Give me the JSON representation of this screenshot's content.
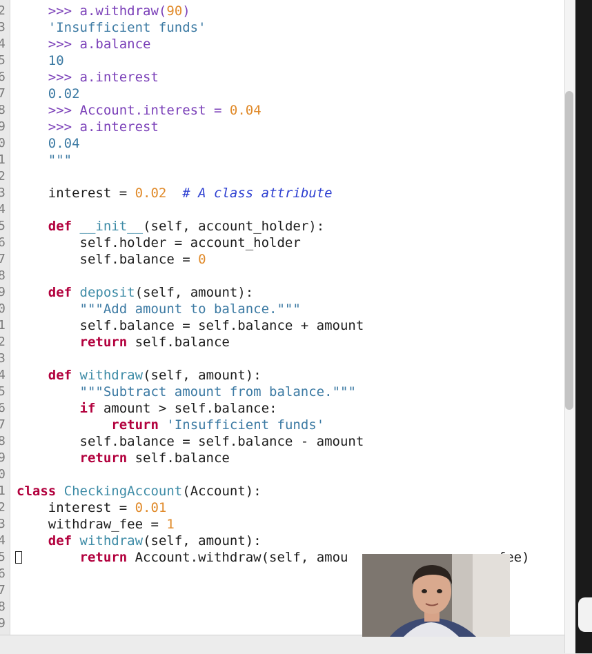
{
  "editor": {
    "lines": [
      {
        "n": "2",
        "tokens": [
          {
            "t": "    "
          },
          {
            "t": ">>> ",
            "c": "prompt"
          },
          {
            "t": "a.withdraw(",
            "c": "prompt"
          },
          {
            "t": "90",
            "c": "num"
          },
          {
            "t": ")",
            "c": "prompt"
          }
        ]
      },
      {
        "n": "3",
        "tokens": [
          {
            "t": "    "
          },
          {
            "t": "'Insufficient funds'",
            "c": "str"
          }
        ]
      },
      {
        "n": "4",
        "tokens": [
          {
            "t": "    "
          },
          {
            "t": ">>> a.balance",
            "c": "prompt"
          }
        ]
      },
      {
        "n": "5",
        "tokens": [
          {
            "t": "    "
          },
          {
            "t": "10",
            "c": "str"
          }
        ]
      },
      {
        "n": "6",
        "tokens": [
          {
            "t": "    "
          },
          {
            "t": ">>> a.interest",
            "c": "prompt"
          }
        ]
      },
      {
        "n": "7",
        "tokens": [
          {
            "t": "    "
          },
          {
            "t": "0.02",
            "c": "str"
          }
        ]
      },
      {
        "n": "8",
        "tokens": [
          {
            "t": "    "
          },
          {
            "t": ">>> Account.interest = ",
            "c": "prompt"
          },
          {
            "t": "0.04",
            "c": "num"
          }
        ]
      },
      {
        "n": "9",
        "tokens": [
          {
            "t": "    "
          },
          {
            "t": ">>> a.interest",
            "c": "prompt"
          }
        ]
      },
      {
        "n": "0",
        "tokens": [
          {
            "t": "    "
          },
          {
            "t": "0.04",
            "c": "str"
          }
        ]
      },
      {
        "n": "1",
        "tokens": [
          {
            "t": "    "
          },
          {
            "t": "\"\"\"",
            "c": "str"
          }
        ]
      },
      {
        "n": "2",
        "tokens": []
      },
      {
        "n": "3",
        "tokens": [
          {
            "t": "    interest = "
          },
          {
            "t": "0.02",
            "c": "num"
          },
          {
            "t": "  "
          },
          {
            "t": "# A class attribute",
            "c": "cmt"
          }
        ]
      },
      {
        "n": "4",
        "tokens": []
      },
      {
        "n": "5",
        "tokens": [
          {
            "t": "    "
          },
          {
            "t": "def",
            "c": "kw"
          },
          {
            "t": " "
          },
          {
            "t": "__init__",
            "c": "fn"
          },
          {
            "t": "(self, account_holder):"
          }
        ]
      },
      {
        "n": "6",
        "tokens": [
          {
            "t": "        self.holder = account_holder"
          }
        ]
      },
      {
        "n": "7",
        "tokens": [
          {
            "t": "        self.balance = "
          },
          {
            "t": "0",
            "c": "num"
          }
        ]
      },
      {
        "n": "8",
        "tokens": []
      },
      {
        "n": "9",
        "tokens": [
          {
            "t": "    "
          },
          {
            "t": "def",
            "c": "kw"
          },
          {
            "t": " "
          },
          {
            "t": "deposit",
            "c": "fn"
          },
          {
            "t": "(self, amount):"
          }
        ]
      },
      {
        "n": "0",
        "tokens": [
          {
            "t": "        "
          },
          {
            "t": "\"\"\"Add amount to balance.\"\"\"",
            "c": "dstr"
          }
        ]
      },
      {
        "n": "1",
        "tokens": [
          {
            "t": "        self.balance = self.balance + amount"
          }
        ]
      },
      {
        "n": "2",
        "tokens": [
          {
            "t": "        "
          },
          {
            "t": "return",
            "c": "kw"
          },
          {
            "t": " self.balance"
          }
        ]
      },
      {
        "n": "3",
        "tokens": []
      },
      {
        "n": "4",
        "tokens": [
          {
            "t": "    "
          },
          {
            "t": "def",
            "c": "kw"
          },
          {
            "t": " "
          },
          {
            "t": "withdraw",
            "c": "fn"
          },
          {
            "t": "(self, amount):"
          }
        ]
      },
      {
        "n": "5",
        "tokens": [
          {
            "t": "        "
          },
          {
            "t": "\"\"\"Subtract amount from balance.\"\"\"",
            "c": "dstr"
          }
        ]
      },
      {
        "n": "6",
        "tokens": [
          {
            "t": "        "
          },
          {
            "t": "if",
            "c": "kw"
          },
          {
            "t": " amount > self.balance:"
          }
        ]
      },
      {
        "n": "7",
        "tokens": [
          {
            "t": "            "
          },
          {
            "t": "return",
            "c": "kw"
          },
          {
            "t": " "
          },
          {
            "t": "'Insufficient funds'",
            "c": "str"
          }
        ]
      },
      {
        "n": "8",
        "tokens": [
          {
            "t": "        self.balance = self.balance - amount"
          }
        ]
      },
      {
        "n": "9",
        "tokens": [
          {
            "t": "        "
          },
          {
            "t": "return",
            "c": "kw"
          },
          {
            "t": " self.balance"
          }
        ]
      },
      {
        "n": "0",
        "tokens": []
      },
      {
        "n": "1",
        "tokens": [
          {
            "t": "class",
            "c": "kw"
          },
          {
            "t": " "
          },
          {
            "t": "CheckingAccount",
            "c": "cls"
          },
          {
            "t": "(Account):"
          }
        ]
      },
      {
        "n": "2",
        "tokens": [
          {
            "t": "    interest = "
          },
          {
            "t": "0.01",
            "c": "num"
          }
        ]
      },
      {
        "n": "3",
        "tokens": [
          {
            "t": "    withdraw_fee = "
          },
          {
            "t": "1",
            "c": "num"
          }
        ]
      },
      {
        "n": "4",
        "tokens": [
          {
            "t": "    "
          },
          {
            "t": "def",
            "c": "kw"
          },
          {
            "t": " "
          },
          {
            "t": "withdraw",
            "c": "fn"
          },
          {
            "t": "(self, amount):"
          }
        ]
      },
      {
        "n": "5",
        "cursor": true,
        "tokens": [
          {
            "t": "        "
          },
          {
            "t": "return",
            "c": "kw"
          },
          {
            "t": " Account.withdraw(self, amou"
          },
          {
            "t": "                  "
          },
          {
            "t": "_fee)"
          }
        ]
      },
      {
        "n": "6",
        "tokens": []
      },
      {
        "n": "7",
        "tokens": []
      },
      {
        "n": "8",
        "tokens": []
      },
      {
        "n": "9",
        "tokens": []
      }
    ]
  },
  "webcam": {
    "description_icon": "presenter-webcam"
  }
}
